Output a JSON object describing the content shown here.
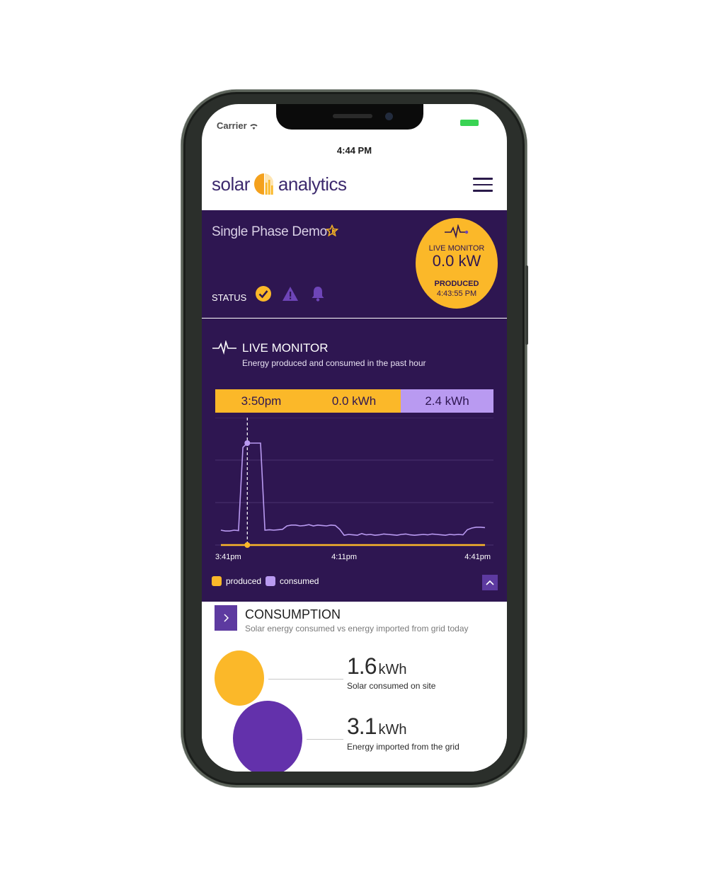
{
  "status_bar": {
    "carrier": "Carrier",
    "time": "4:44 PM"
  },
  "header": {
    "logo_left": "solar",
    "logo_right": "analytics",
    "menu_icon": "hamburger-menu-icon"
  },
  "site": {
    "name": "Single Phase Demo",
    "status_label": "STATUS",
    "status_icons": [
      "check-circle-icon",
      "warning-icon",
      "bell-icon"
    ]
  },
  "live_badge": {
    "title": "LIVE MONITOR",
    "value": "0.0 kW",
    "state": "PRODUCED",
    "time": "4:43:55 PM"
  },
  "live_monitor": {
    "title": "LIVE MONITOR",
    "subtitle": "Energy produced and consumed in the past hour",
    "tooltip": {
      "time": "3:50pm",
      "produced": "0.0 kWh",
      "consumed": "2.4 kWh"
    },
    "legend": {
      "produced": "produced",
      "consumed": "consumed"
    },
    "colors": {
      "produced": "#fbb829",
      "consumed": "#b99af1"
    }
  },
  "chart_data": {
    "type": "line",
    "xlabels": [
      "3:41pm",
      "4:11pm",
      "4:41pm"
    ],
    "series": [
      {
        "name": "produced",
        "color": "#fbb829",
        "values": [
          0,
          0,
          0,
          0,
          0,
          0,
          0,
          0,
          0,
          0,
          0,
          0,
          0,
          0,
          0,
          0,
          0,
          0,
          0,
          0,
          0,
          0,
          0,
          0,
          0,
          0,
          0,
          0,
          0,
          0,
          0,
          0,
          0,
          0,
          0,
          0,
          0,
          0,
          0,
          0,
          0,
          0,
          0,
          0,
          0,
          0,
          0,
          0,
          0,
          0,
          0,
          0,
          0,
          0,
          0,
          0,
          0,
          0,
          0,
          0,
          0
        ]
      },
      {
        "name": "consumed",
        "color": "#b99af1",
        "values": [
          0.35,
          0.33,
          0.33,
          0.35,
          0.34,
          2.3,
          2.4,
          2.4,
          2.4,
          2.4,
          0.35,
          0.36,
          0.35,
          0.36,
          0.37,
          0.45,
          0.47,
          0.47,
          0.45,
          0.46,
          0.48,
          0.45,
          0.47,
          0.46,
          0.45,
          0.47,
          0.46,
          0.37,
          0.23,
          0.25,
          0.24,
          0.23,
          0.27,
          0.24,
          0.25,
          0.23,
          0.24,
          0.26,
          0.25,
          0.24,
          0.23,
          0.25,
          0.26,
          0.24,
          0.23,
          0.24,
          0.25,
          0.24,
          0.26,
          0.25,
          0.24,
          0.23,
          0.25,
          0.24,
          0.25,
          0.24,
          0.36,
          0.4,
          0.42,
          0.42,
          0.41
        ]
      }
    ],
    "ylim": [
      0,
      3
    ],
    "highlight_index": 6,
    "grid": true
  },
  "consumption": {
    "title": "CONSUMPTION",
    "subtitle": "Solar energy consumed vs energy imported from grid today",
    "solar": {
      "value": "1.6",
      "unit": "kWh",
      "caption": "Solar consumed on site",
      "fraction": 0.34,
      "color": "#fbb829"
    },
    "grid": {
      "value": "3.1",
      "unit": "kWh",
      "caption": "Energy imported from the grid",
      "fraction": 0.66,
      "color": "#6331ab"
    }
  }
}
